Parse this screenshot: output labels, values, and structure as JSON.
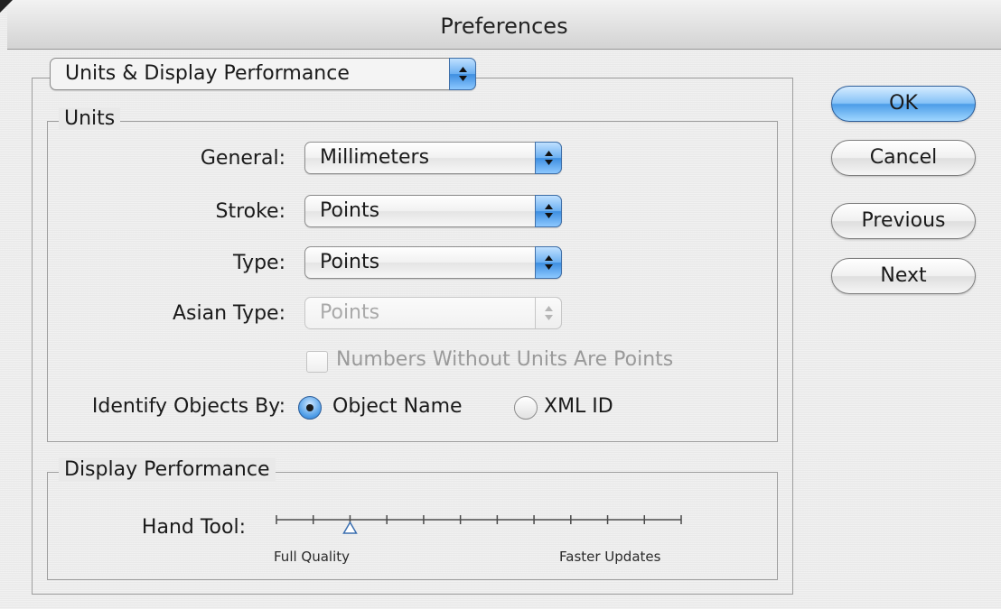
{
  "window": {
    "title": "Preferences"
  },
  "panel_select": {
    "value": "Units & Display Performance"
  },
  "units": {
    "group_title": "Units",
    "general": {
      "label": "General:",
      "value": "Millimeters"
    },
    "stroke": {
      "label": "Stroke:",
      "value": "Points"
    },
    "type": {
      "label": "Type:",
      "value": "Points"
    },
    "asian_type": {
      "label": "Asian Type:",
      "value": "Points",
      "enabled": false
    },
    "numbers_checkbox": {
      "label": "Numbers Without Units Are Points",
      "checked": false,
      "enabled": false
    },
    "identify": {
      "label": "Identify Objects By:",
      "options": [
        {
          "label": "Object Name",
          "selected": true
        },
        {
          "label": "XML ID",
          "selected": false
        }
      ]
    }
  },
  "display_performance": {
    "group_title": "Display Performance",
    "hand_tool": {
      "label": "Hand Tool:",
      "left_caption": "Full Quality",
      "right_caption": "Faster Updates",
      "tick_count": 12,
      "position_index": 2
    }
  },
  "buttons": {
    "ok": "OK",
    "cancel": "Cancel",
    "previous": "Previous",
    "next": "Next"
  },
  "colors": {
    "accent": "#4c9de8",
    "disabled_text": "#a9a9a9"
  }
}
